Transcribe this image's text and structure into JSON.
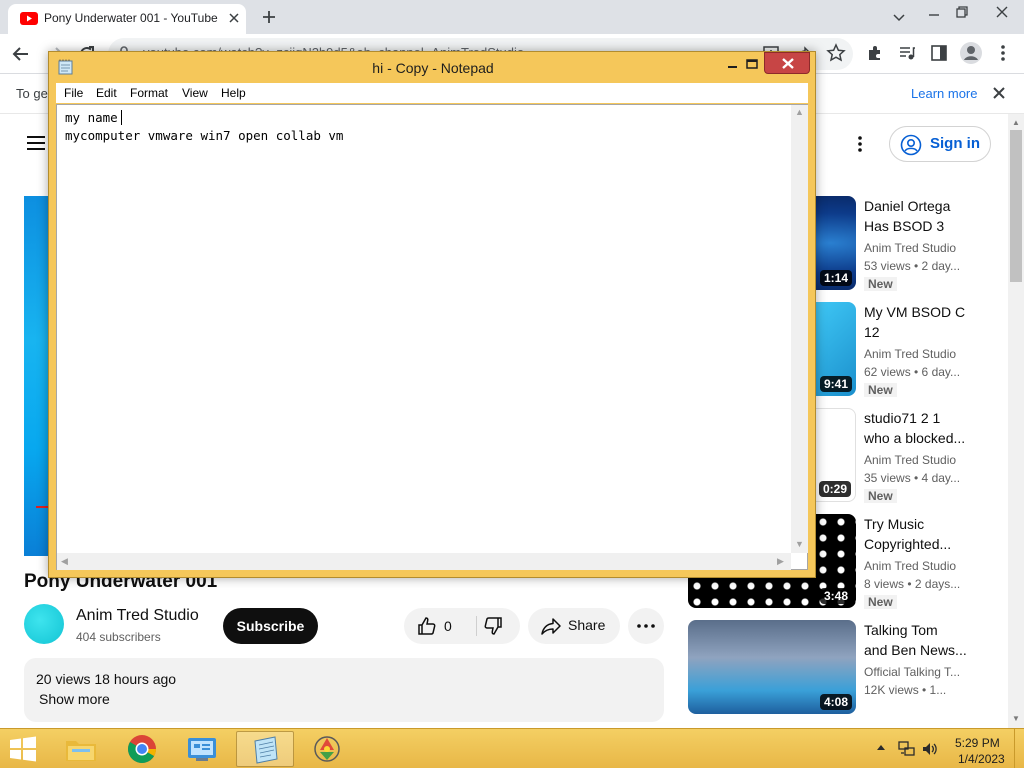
{
  "browser": {
    "tab_title": "Pony Underwater 001 - YouTube",
    "url": "youtube.com/watch?v=zciiqN2b9d5&ab_channel=AnimTredStudio",
    "infobar_text": "To ge",
    "learn_more": "Learn more"
  },
  "youtube": {
    "sign_in": "Sign in",
    "video_title": "Pony Underwater 001",
    "channel_name": "Anim Tred Studio",
    "subscribers": "404 subscribers",
    "subscribe": "Subscribe",
    "likes": "0",
    "share": "Share",
    "views_time": "20 views  18 hours ago",
    "show_more": "Show more",
    "recommendations": [
      {
        "title_line1": "Daniel Ortega",
        "title_line2": "Has BSOD 3",
        "channel": "Anim Tred Studio",
        "meta": "53 views  • 2 day...",
        "badge": "New",
        "duration": "1:14"
      },
      {
        "title_line1": "My VM BSOD C",
        "title_line2": "12",
        "channel": "Anim Tred Studio",
        "meta": "62 views  • 6 day...",
        "badge": "New",
        "duration": "9:41"
      },
      {
        "title_line1": "studio71 2 1",
        "title_line2": "who a blocked...",
        "channel": "Anim Tred Studio",
        "meta": "35 views  • 4 day...",
        "badge": "New",
        "duration": "0:29"
      },
      {
        "title_line1": "Try Music",
        "title_line2": "Copyrighted...",
        "channel": "Anim Tred Studio",
        "meta": "8 views  • 2 days...",
        "badge": "New",
        "duration": "3:48"
      },
      {
        "title_line1": "Talking Tom",
        "title_line2": "and Ben News...",
        "channel": "Official Talking T...",
        "meta": "12K views  • 1...",
        "badge": "",
        "duration": "4:08"
      }
    ]
  },
  "notepad": {
    "title": "hi - Copy - Notepad",
    "menu": [
      "File",
      "Edit",
      "Format",
      "View",
      "Help"
    ],
    "line1": "my name",
    "line2": "mycomputer vmware win7 open collab vm"
  },
  "taskbar": {
    "time": "5:29 PM",
    "date": "1/4/2023"
  },
  "colors": {
    "youtube_red": "#ff0000",
    "link_blue": "#065fd4",
    "notepad_frame": "#f5c75a",
    "taskbar": "#e8b747",
    "close_red": "#c74545"
  }
}
